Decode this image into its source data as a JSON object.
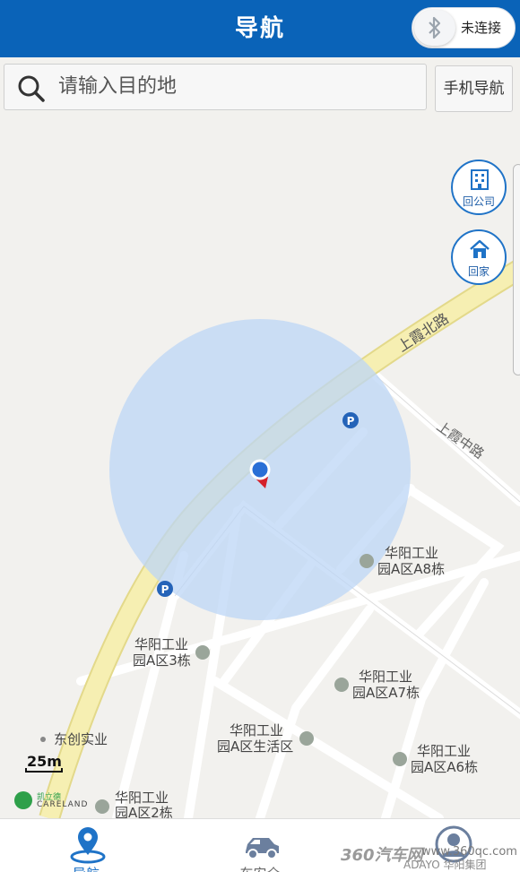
{
  "header": {
    "title": "导航",
    "bluetooth_status": "未连接"
  },
  "search": {
    "placeholder": "请输入目的地",
    "phone_nav_label": "手机导航"
  },
  "quick_actions": {
    "company_label": "回公司",
    "home_label": "回家"
  },
  "map": {
    "roads": [
      "上霞北路",
      "上霞中路"
    ],
    "pois": [
      {
        "name_line1": "华阳工业",
        "name_line2": "园A区A8栋"
      },
      {
        "name_line1": "华阳工业",
        "name_line2": "园A区3栋"
      },
      {
        "name_line1": "华阳工业",
        "name_line2": "园A区A7栋"
      },
      {
        "name_line1": "华阳工业",
        "name_line2": "园A区生活区"
      },
      {
        "name_line1": "华阳工业",
        "name_line2": "园A区A6栋"
      },
      {
        "name_line1": "华阳工业",
        "name_line2": "园A区2栋"
      },
      {
        "name_line1": "东创实业",
        "name_line2": ""
      }
    ],
    "parking_symbol": "P",
    "scale": "25m",
    "logo_cn": "凯立德",
    "logo_en": "CARELAND",
    "colors": {
      "accuracy_circle": "#bcd6f5",
      "main_road": "#f6efb2",
      "location_dot": "#2a6fd6"
    }
  },
  "tabs": [
    {
      "label": "导航",
      "icon": "nav-pin-icon",
      "active": true
    },
    {
      "label": "车安全",
      "icon": "car-icon",
      "active": false
    },
    {
      "label": "",
      "icon": "user-icon",
      "active": false
    }
  ],
  "watermark": {
    "main": "360汽车网",
    "url": "www.360qc.com",
    "sub": "ADAYO 华阳集团"
  },
  "colors": {
    "header_bg": "#0a63b8",
    "accent": "#1f73c7"
  }
}
